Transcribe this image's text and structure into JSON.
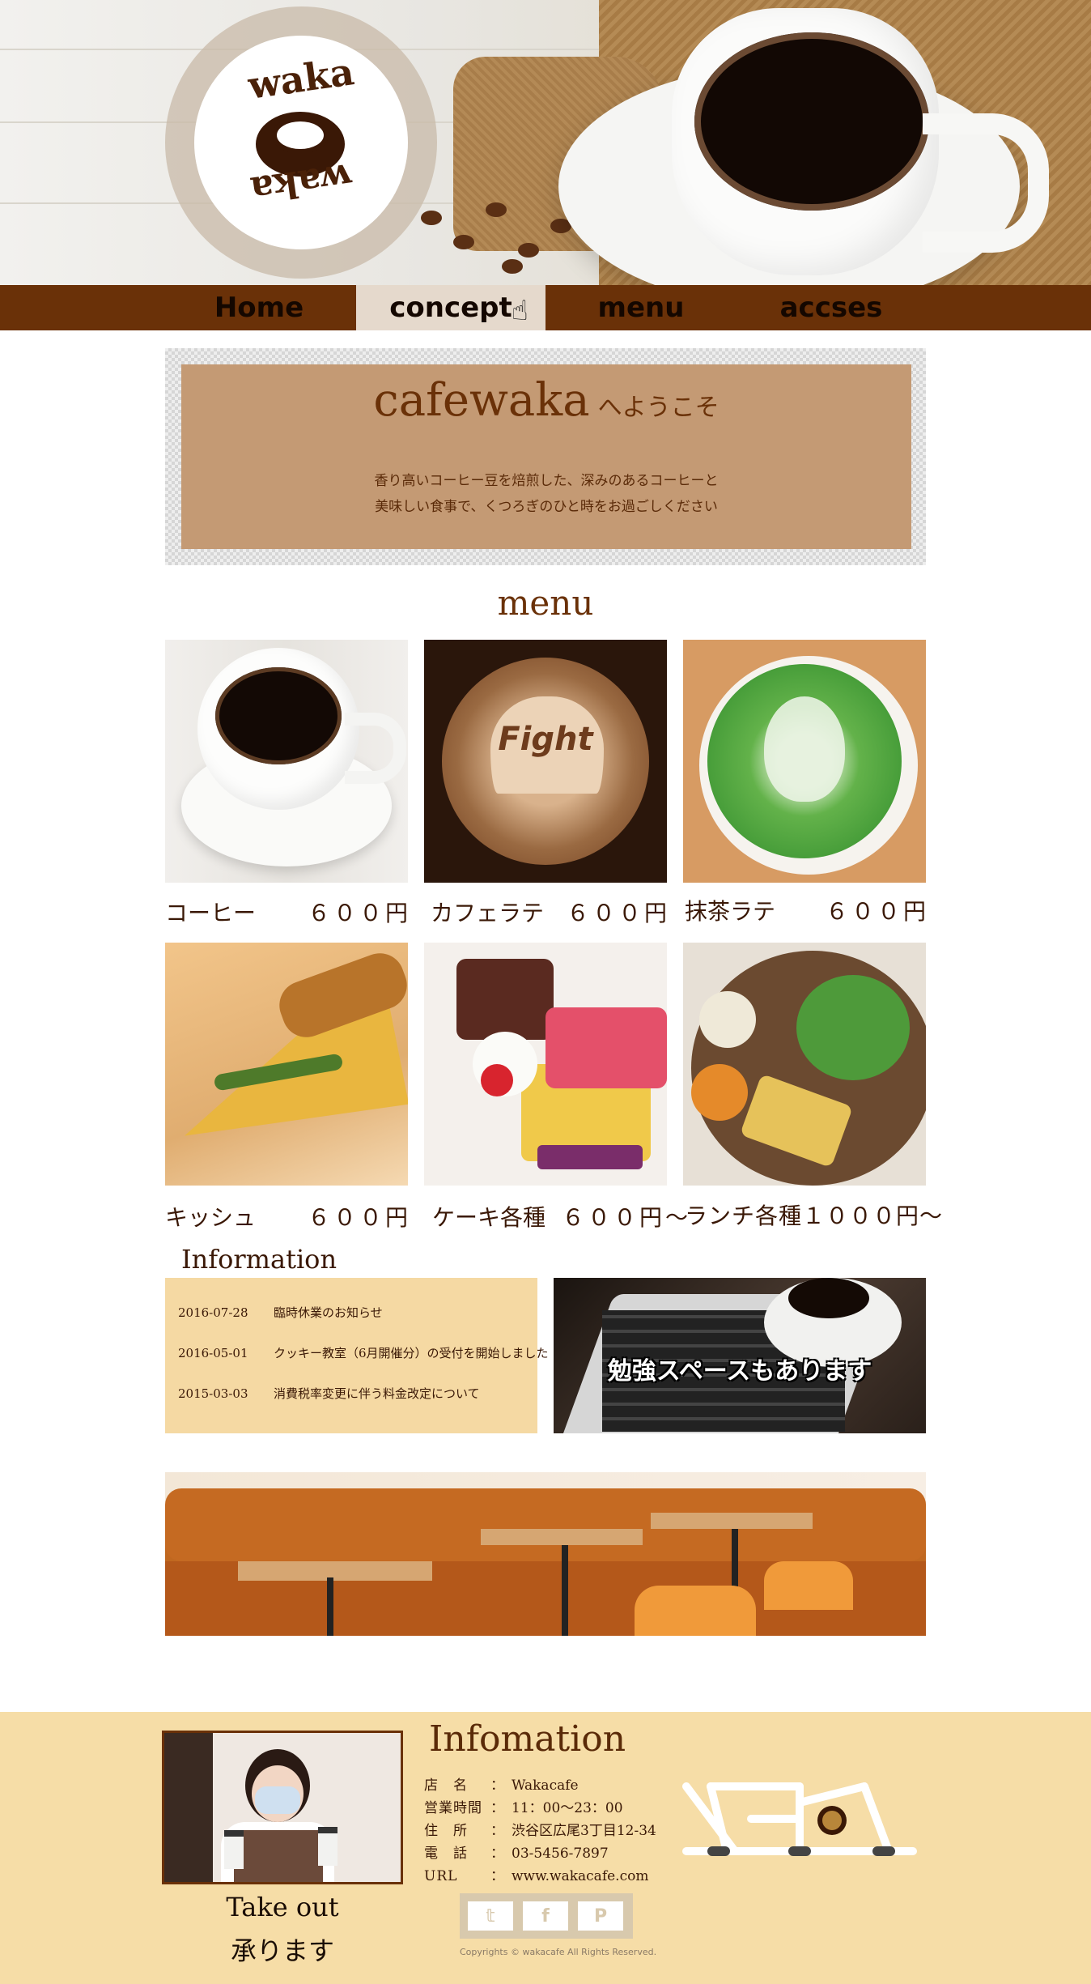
{
  "logo": {
    "text_top": "waka",
    "text_bottom": "waka"
  },
  "nav": [
    {
      "label": "Home"
    },
    {
      "label": "concept"
    },
    {
      "label": "menu"
    },
    {
      "label": "accses"
    }
  ],
  "welcome": {
    "title": "cafewaka",
    "subtitle": "へようこそ",
    "line1": "香り高いコーヒー豆を焙煎した、深みのあるコーヒーと",
    "line2": "美味しい食事で、くつろぎのひと時をお過ごしください"
  },
  "menu": {
    "heading": "menu",
    "items": [
      {
        "name": "コーヒー",
        "price": "６００円"
      },
      {
        "name": "カフェラテ",
        "price": "６００円"
      },
      {
        "name": "抹茶ラテ",
        "price": "６００円"
      },
      {
        "name": "キッシュ",
        "price": "６００円"
      },
      {
        "name": "ケーキ各種",
        "price": "６００円〜"
      },
      {
        "name": "ランチ各種１０００円〜",
        "price": ""
      }
    ],
    "latte_art_text": "Fight"
  },
  "information": {
    "heading": "Information",
    "news": [
      {
        "date": "2016-07-28",
        "text": "臨時休業のお知らせ"
      },
      {
        "date": "2016-05-01",
        "text": "クッキー教室（6月開催分）の受付を開始しました"
      },
      {
        "date": "2015-03-03",
        "text": "消費税率変更に伴う料金改定について"
      }
    ],
    "study_banner": "勉強スペースもあります"
  },
  "footer": {
    "takeout_line1": "Take out",
    "takeout_line2": "承ります",
    "title": "Infomation",
    "rows": [
      {
        "key": "店　名",
        "sep": "：",
        "value": "Wakacafe"
      },
      {
        "key": "営業時間",
        "sep": "：",
        "value": "11：00〜23：00"
      },
      {
        "key": "住　所",
        "sep": "：",
        "value": "渋谷区広尾3丁目12-34"
      },
      {
        "key": "電　話",
        "sep": "：",
        "value": "03-5456-7897"
      },
      {
        "key": "URL",
        "sep": "：",
        "value": "www.wakacafe.com"
      }
    ],
    "social": [
      {
        "icon": "twitter-icon",
        "glyph": "𝕥"
      },
      {
        "icon": "facebook-icon",
        "glyph": "f"
      },
      {
        "icon": "pinterest-icon",
        "glyph": "P"
      }
    ],
    "copyright": "Copyrights © wakacafe All Rights Reserved."
  },
  "colors": {
    "nav": "#6a3108",
    "welcome_box": "#c49a74",
    "info_box": "#f5d9a3",
    "footer": "#f6dda7",
    "text_brown": "#5a2a08"
  }
}
